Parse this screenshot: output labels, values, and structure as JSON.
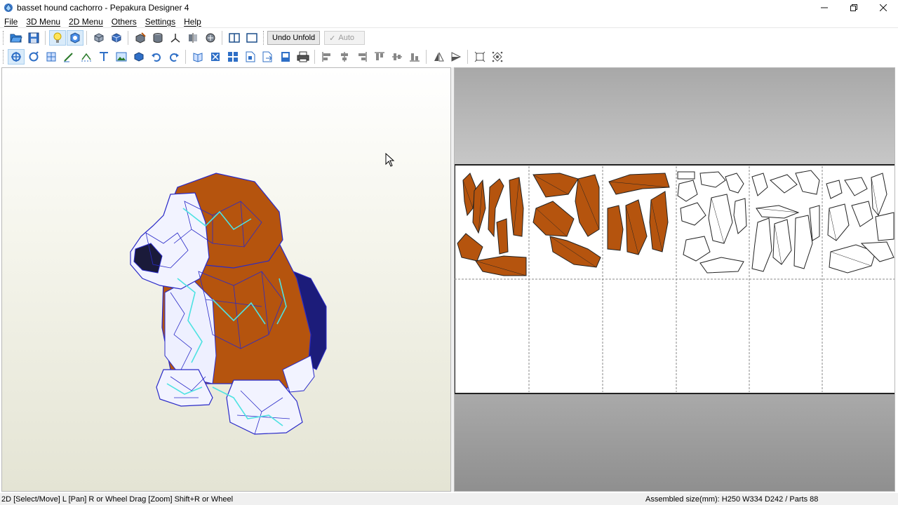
{
  "window": {
    "title": "basset hound cachorro - Pepakura Designer 4",
    "minimize_icon": "minimize-icon",
    "maximize_icon": "restore-icon",
    "close_icon": "close-icon"
  },
  "menu": {
    "items": [
      {
        "label": "File"
      },
      {
        "label": "3D Menu"
      },
      {
        "label": "2D Menu"
      },
      {
        "label": "Others"
      },
      {
        "label": "Settings"
      },
      {
        "label": "Help"
      }
    ]
  },
  "toolbar1": {
    "undo_unfold_label": "Undo Unfold",
    "auto_label": "Auto",
    "auto_checked": true,
    "icons": [
      "open-file-icon",
      "save-icon",
      "light-icon",
      "texture-icon",
      "rotate-model-icon",
      "rotate-flip-icon",
      "cube-edit-icon",
      "cylinder-icon",
      "axis-icon",
      "mirror-icon",
      "link-icon",
      "split-view-icon",
      "single-view-icon"
    ]
  },
  "toolbar2": {
    "icons": [
      "select-move-icon",
      "rotate-icon",
      "join-parts-icon",
      "pen-icon",
      "fold-line-icon",
      "text-icon",
      "image-icon",
      "move-parts-icon",
      "undo-icon",
      "redo-icon",
      "unfold-icon",
      "scale-icon",
      "arrange-icon",
      "page-icon",
      "export-icon",
      "print-preview-icon",
      "print-icon",
      "align-left-icon",
      "align-center-icon",
      "align-right-icon",
      "align-top-icon",
      "align-middle-icon",
      "align-bottom-icon",
      "flip-h-icon",
      "flip-v-icon",
      "fit-icon",
      "grid-icon"
    ]
  },
  "viewport3d": {
    "model_colors": {
      "fur": "#b5540e",
      "wire": "#2a2ac8",
      "seam": "#4ee2e2",
      "white": "#f4f4ff"
    }
  },
  "viewport2d": {
    "sheet_count": 6,
    "part_color": "#b5540e",
    "sheets_filled": [
      true,
      true,
      true,
      false,
      false,
      false
    ]
  },
  "status": {
    "left": "2D [Select/Move] L [Pan] R or Wheel Drag [Zoom] Shift+R or Wheel",
    "right": "Assembled size(mm): H250 W334 D242 / Parts 88"
  }
}
